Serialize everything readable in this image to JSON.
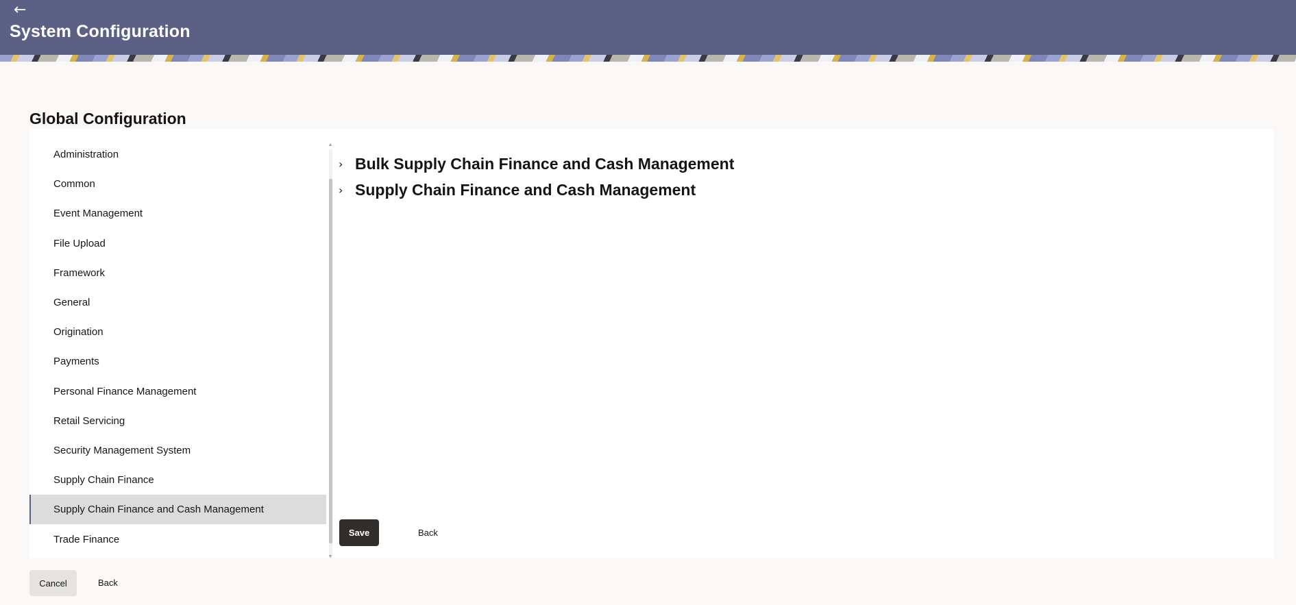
{
  "header": {
    "back_icon": "arrow-left-icon",
    "back_glyph": "←",
    "title": "System Configuration"
  },
  "page": {
    "heading": "Global Configuration"
  },
  "sidebar": {
    "items": [
      {
        "label": "Administration"
      },
      {
        "label": "Common"
      },
      {
        "label": "Event Management"
      },
      {
        "label": "File Upload"
      },
      {
        "label": "Framework"
      },
      {
        "label": "General"
      },
      {
        "label": "Origination"
      },
      {
        "label": "Payments"
      },
      {
        "label": "Personal Finance Management"
      },
      {
        "label": "Retail Servicing"
      },
      {
        "label": "Security Management System"
      },
      {
        "label": "Supply Chain Finance"
      },
      {
        "label": "Supply Chain Finance and Cash Management",
        "selected": true
      },
      {
        "label": "Trade Finance"
      }
    ]
  },
  "content": {
    "sections": [
      {
        "title": "Bulk Supply Chain Finance and Cash Management",
        "icon": "chevron-right-icon",
        "glyph": "›"
      },
      {
        "title": "Supply Chain Finance and Cash Management",
        "icon": "chevron-right-icon",
        "glyph": "›"
      }
    ],
    "save_label": "Save",
    "back_label": "Back"
  },
  "footer": {
    "cancel_label": "Cancel",
    "back_label": "Back"
  },
  "colors": {
    "header_bg": "#5b6084",
    "primary_button": "#312d2a",
    "selected_item_bg": "#dcdcdc",
    "page_bg": "#f9f8f6"
  }
}
